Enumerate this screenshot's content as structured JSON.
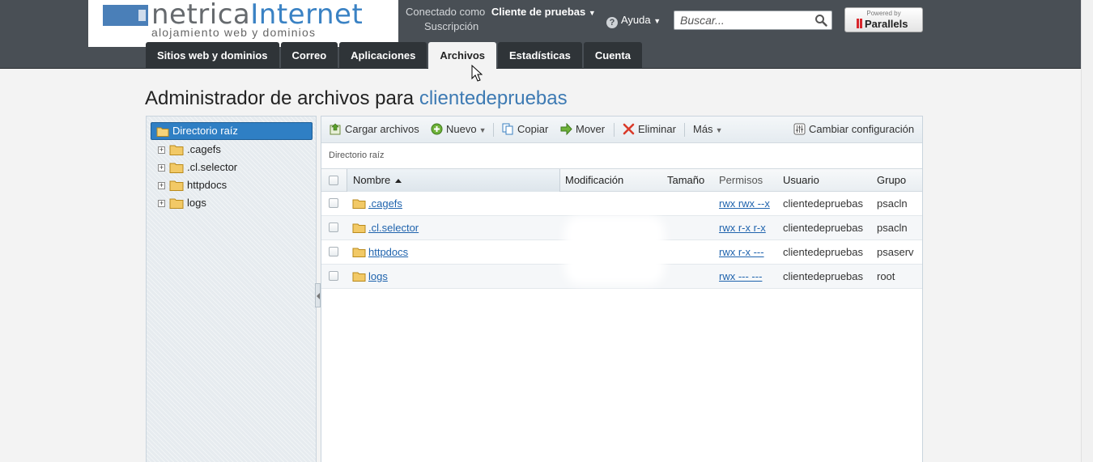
{
  "brand": {
    "name_part1": "netrica",
    "name_part2": "Internet",
    "tagline": "alojamiento web y dominios"
  },
  "header": {
    "connected_as_label": "Conectado como",
    "user_name": "Cliente de pruebas",
    "subscription_label": "Suscripción",
    "help_label": "Ayuda",
    "search_placeholder": "Buscar...",
    "powered_by": "Powered by",
    "powered_brand": "Parallels"
  },
  "tabs": [
    {
      "label": "Sitios web y dominios",
      "active": false
    },
    {
      "label": "Correo",
      "active": false
    },
    {
      "label": "Aplicaciones",
      "active": false
    },
    {
      "label": "Archivos",
      "active": true
    },
    {
      "label": "Estadísticas",
      "active": false
    },
    {
      "label": "Cuenta",
      "active": false
    }
  ],
  "page": {
    "title_prefix": "Administrador de archivos para",
    "title_subject": "clientedepruebas"
  },
  "tree": {
    "root_label": "Directorio raíz",
    "items": [
      {
        "label": ".cagefs"
      },
      {
        "label": ".cl.selector"
      },
      {
        "label": "httpdocs"
      },
      {
        "label": "logs"
      }
    ]
  },
  "toolbar": {
    "upload_label": "Cargar archivos",
    "new_label": "Nuevo",
    "copy_label": "Copiar",
    "move_label": "Mover",
    "delete_label": "Eliminar",
    "more_label": "Más",
    "settings_label": "Cambiar configuración"
  },
  "breadcrumb": "Directorio raíz",
  "table": {
    "columns": {
      "name": "Nombre",
      "modified": "Modificación",
      "size": "Tamaño",
      "permissions": "Permisos",
      "user": "Usuario",
      "group": "Grupo"
    },
    "rows": [
      {
        "name": ".cagefs",
        "permissions": "rwx rwx --x",
        "user": "clientedepruebas",
        "group": "psacln"
      },
      {
        "name": ".cl.selector",
        "permissions": "rwx r-x r-x",
        "user": "clientedepruebas",
        "group": "psacln"
      },
      {
        "name": "httpdocs",
        "permissions": "rwx r-x ---",
        "user": "clientedepruebas",
        "group": "psaserv"
      },
      {
        "name": "logs",
        "permissions": "rwx --- ---",
        "user": "clientedepruebas",
        "group": "root"
      }
    ]
  },
  "colors": {
    "header_bg": "#494f55",
    "tab_bg": "#2f3438",
    "accent": "#3d7ab3",
    "tree_selected": "#2f7fc4",
    "link": "#1f63ad"
  }
}
